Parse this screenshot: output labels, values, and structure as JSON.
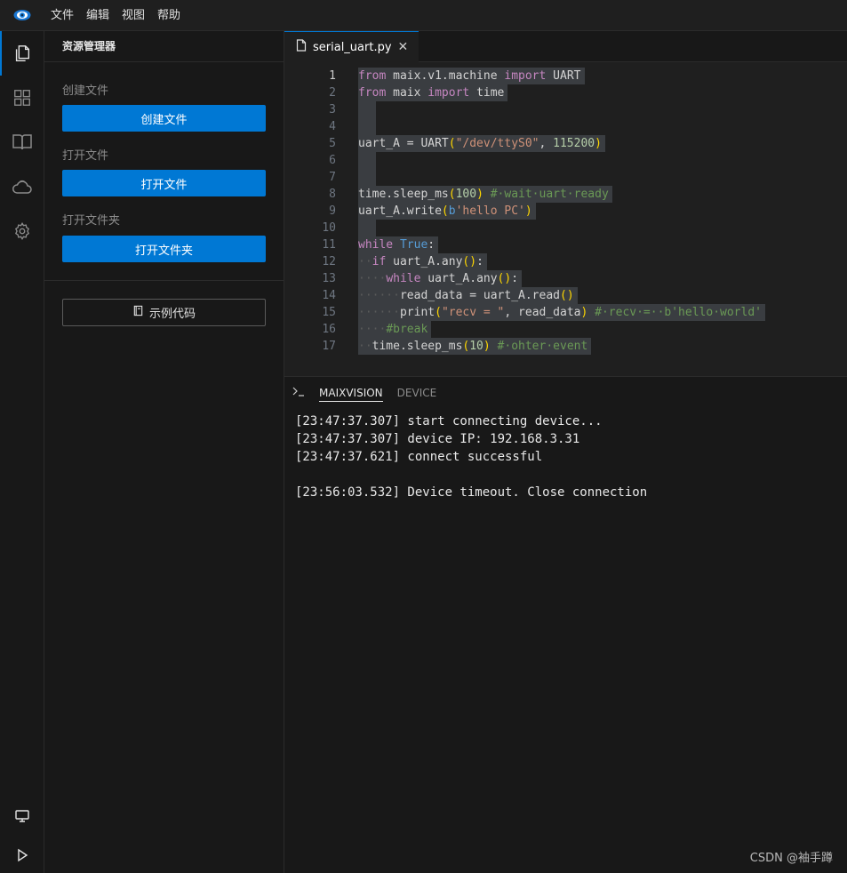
{
  "menubar": {
    "items": [
      "文件",
      "编辑",
      "视图",
      "帮助"
    ]
  },
  "activitybar": {
    "icons": [
      "files-icon",
      "extensions-icon",
      "book-icon",
      "cloud-icon",
      "settings-icon",
      "monitor-icon",
      "run-icon"
    ]
  },
  "sidebar": {
    "title": "资源管理器",
    "create_label": "创建文件",
    "create_button": "创建文件",
    "open_label": "打开文件",
    "open_button": "打开文件",
    "open_folder_label": "打开文件夹",
    "open_folder_button": "打开文件夹",
    "examples_button": "示例代码"
  },
  "editor": {
    "tab_name": "serial_uart.py",
    "current_line": 1,
    "lines": [
      "from maix.v1.machine import UART",
      "from maix import time",
      "",
      "",
      "uart_A = UART(\"/dev/ttyS0\", 115200)",
      "",
      "",
      "time.sleep_ms(100) # wait uart ready",
      "uart_A.write(b'hello PC')",
      "",
      "while True:",
      "  if uart_A.any():",
      "    while uart_A.any():",
      "      read_data = uart_A.read()",
      "      print(\"recv = \", read_data) # recv =  b'hello world'",
      "    #break",
      "  time.sleep_ms(10) # ohter event"
    ]
  },
  "panel": {
    "terminal_icon": "terminal-icon",
    "tabs": [
      "MAIXVISION",
      "DEVICE"
    ],
    "active_tab": "MAIXVISION",
    "log": [
      "[23:47:37.307] start connecting device...",
      "[23:47:37.307] device IP: 192.168.3.31",
      "[23:47:37.621] connect successful",
      "",
      "[23:56:03.532] Device timeout. Close connection"
    ]
  },
  "watermark": "CSDN @袖手蹲",
  "colors": {
    "accent": "#0078d4",
    "background": "#1f1f1f",
    "keyword": "#c586c0",
    "string": "#ce9178",
    "number": "#b5cea8",
    "comment": "#6a9955"
  }
}
